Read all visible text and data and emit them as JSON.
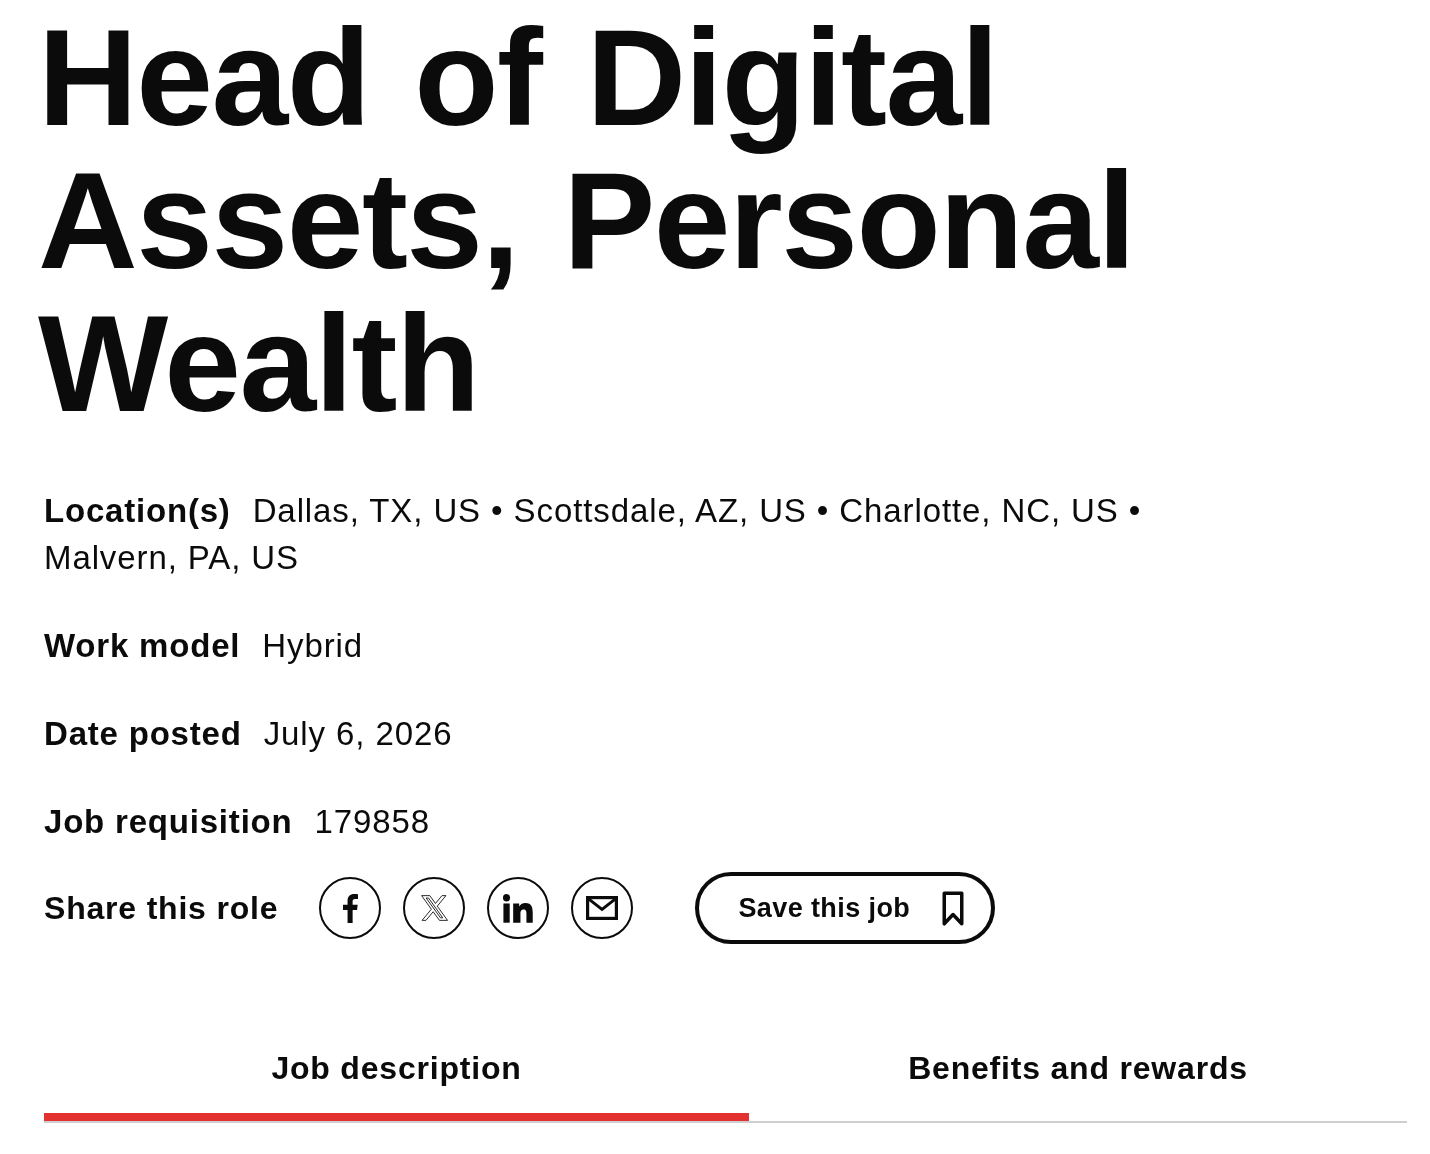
{
  "job": {
    "title": "Head of Digital Assets, Personal Wealth"
  },
  "details": [
    {
      "label": "Location(s)",
      "value": "Dallas, TX, US • Scottsdale, AZ, US • Charlotte, NC, US • Malvern, PA, US"
    },
    {
      "label": "Work model",
      "value": "Hybrid"
    },
    {
      "label": "Date posted",
      "value": "July 6, 2026"
    },
    {
      "label": "Job requisition",
      "value": "179858"
    }
  ],
  "share": {
    "label": "Share this role",
    "links": [
      {
        "kind": "facebook"
      },
      {
        "kind": "x"
      },
      {
        "kind": "linkedin"
      },
      {
        "kind": "email"
      }
    ]
  },
  "save_button": {
    "label": "Save this job"
  },
  "tabs": [
    {
      "label": "Job description",
      "selected": true
    },
    {
      "label": "Benefits and rewards",
      "selected": false
    }
  ]
}
